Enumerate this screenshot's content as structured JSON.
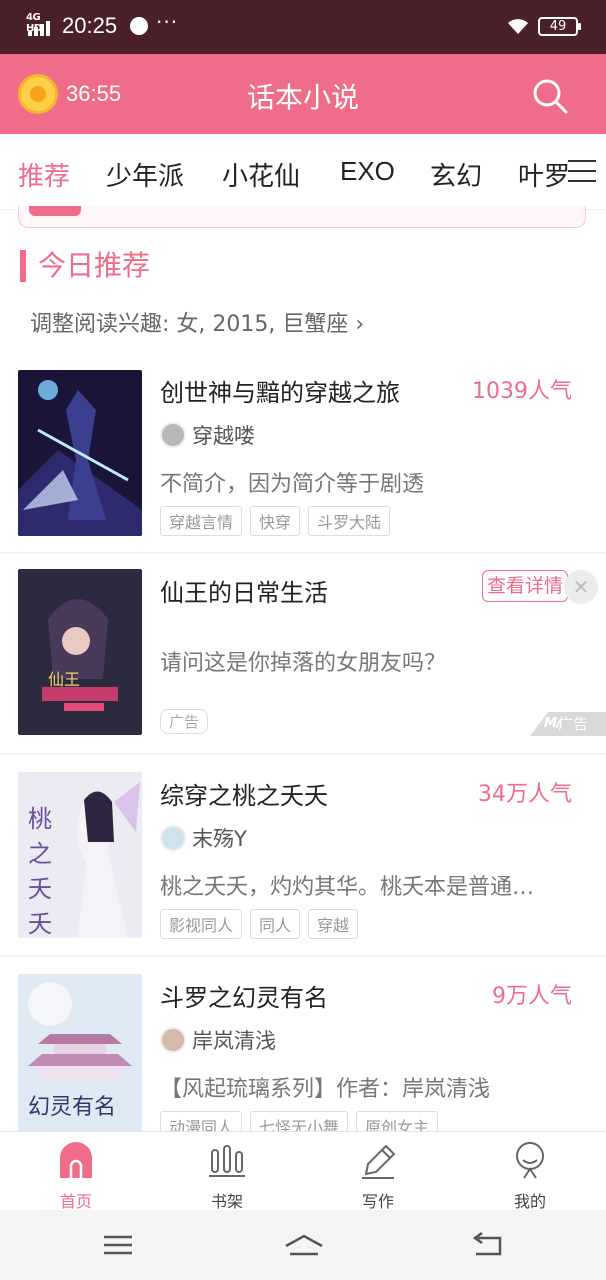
{
  "status_bar": {
    "network": "4G HD",
    "time": "20:25",
    "more": "···",
    "battery": "49"
  },
  "header": {
    "timer": "36:55",
    "title": "话本小说"
  },
  "tabs": [
    "推荐",
    "少年派",
    "小花仙",
    "EXO",
    "玄幻",
    "叶罗"
  ],
  "section": {
    "title": "今日推荐",
    "interest": "调整阅读兴趣: 女, 2015, 巨蟹座 ›"
  },
  "books": [
    {
      "title": "创世神与黯的穿越之旅",
      "popularity": "1039人气",
      "author": "穿越喽",
      "desc": "不简介，因为简介等于剧透",
      "tags": [
        "穿越言情",
        "快穿",
        "斗罗大陆"
      ]
    },
    {
      "title": "综穿之桃之夭夭",
      "popularity": "34万人气",
      "author": "末殇Y",
      "desc": "桃之夭夭，灼灼其华。桃夭本是普通…",
      "tags": [
        "影视同人",
        "同人",
        "穿越"
      ]
    },
    {
      "title": "斗罗之幻灵有名",
      "popularity": "9万人气",
      "author": "岸岚清浅",
      "desc": "【风起琉璃系列】作者：岸岚清浅",
      "tags": [
        "动漫同人",
        "七怪无小舞",
        "原创女主"
      ]
    }
  ],
  "ad": {
    "title": "仙王的日常生活",
    "desc": "请问这是你掉落的女朋友吗？",
    "detail_label": "查看详情",
    "tag": "广告",
    "corner_label": "广告",
    "close": "✕"
  },
  "bottom_nav": [
    "首页",
    "书架",
    "写作",
    "我的"
  ],
  "colors": {
    "accent": "#f06d8a",
    "status_bar": "#4a2129"
  }
}
